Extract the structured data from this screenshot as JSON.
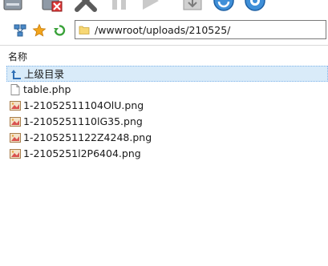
{
  "address": {
    "path": "/wwwroot/uploads/210525/"
  },
  "list": {
    "column_name": "名称",
    "items": [
      {
        "label": "上级目录",
        "icon": "up-arrow-icon",
        "selected": true
      },
      {
        "label": "table.php",
        "icon": "file-icon",
        "selected": false
      },
      {
        "label": "1-21052511104OlU.png",
        "icon": "image-icon",
        "selected": false
      },
      {
        "label": "1-2105251110lG35.png",
        "icon": "image-icon",
        "selected": false
      },
      {
        "label": "1-2105251122Z4248.png",
        "icon": "image-icon",
        "selected": false
      },
      {
        "label": "1-2105251l2P6404.png",
        "icon": "image-icon",
        "selected": false
      }
    ]
  },
  "colors": {
    "selection_bg": "#d9ebf9",
    "selection_border": "#7eb4ea"
  }
}
